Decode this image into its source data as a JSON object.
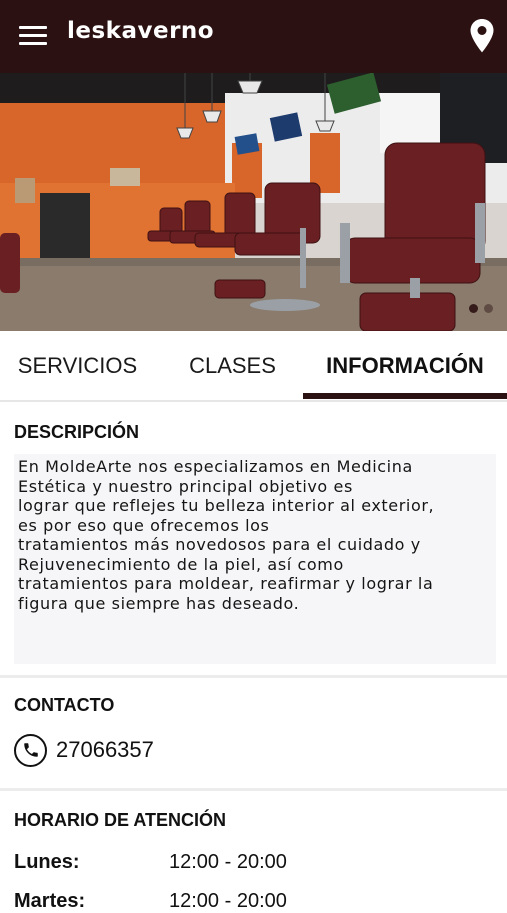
{
  "app": {
    "title": "leskaverno",
    "icons": {
      "menu": "hamburger-menu-icon",
      "location": "map-pin-icon"
    },
    "colors": {
      "appbar": "#2b1111",
      "accent": "#2b1111",
      "section_bg": "#f6f6f8"
    }
  },
  "tabs": [
    {
      "label": "SERVICIOS",
      "active": false
    },
    {
      "label": "CLASES",
      "active": false
    },
    {
      "label": "INFORMACIÓN",
      "active": true
    }
  ],
  "carousel": {
    "slides": 2,
    "active_index": 0
  },
  "description": {
    "title": "DESCRIPCIÓN",
    "text": "En MoldeArte nos especializamos en Medicina\nEstética y nuestro principal objetivo es\nlograr que reflejes tu belleza interior al exterior,\nes por eso que ofrecemos los\ntratamientos más novedosos para el cuidado y\nRejuvenecimiento de la piel, así como\ntratamientos para moldear, reafirmar y lograr la\nfigura que siempre has deseado."
  },
  "contact": {
    "title": "CONTACTO",
    "phone": "27066357",
    "icon": "phone-icon"
  },
  "schedule": {
    "title": "HORARIO DE ATENCIÓN",
    "rows": [
      {
        "day": "Lunes:",
        "hours": "12:00 - 20:00"
      },
      {
        "day": "Martes:",
        "hours": "12:00 - 20:00"
      }
    ]
  }
}
